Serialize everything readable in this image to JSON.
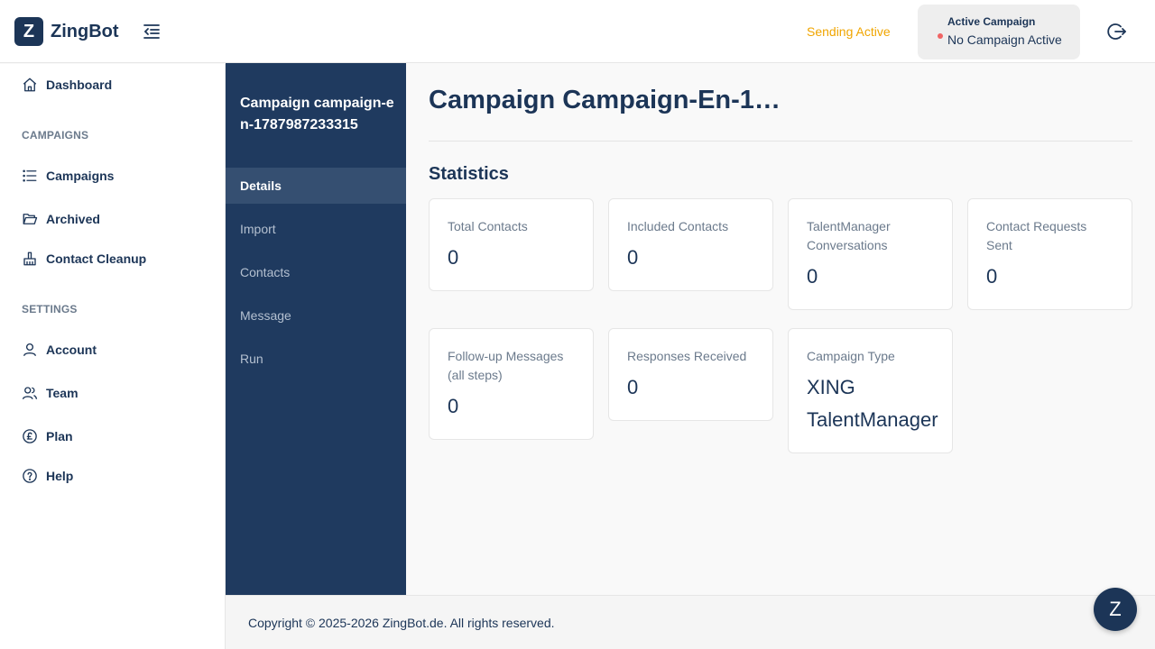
{
  "app": {
    "logo_letter": "Z",
    "name": "ZingBot"
  },
  "header": {
    "sending_status": "Sending Active",
    "active_campaign_title": "Active Campaign",
    "active_campaign_value": "No Campaign Active",
    "status_color": "#f0a500"
  },
  "sidebar": {
    "dashboard": "Dashboard",
    "campaigns_section": "CAMPAIGNS",
    "campaigns": "Campaigns",
    "archived": "Archived",
    "contact_cleanup": "Contact Cleanup",
    "settings_section": "SETTINGS",
    "account": "Account",
    "team": "Team",
    "plan": "Plan",
    "help": "Help"
  },
  "subnav": {
    "title": "Campaign campaign-en-1787987233315",
    "items": [
      "Details",
      "Import",
      "Contacts",
      "Message",
      "Run"
    ],
    "active": "Details"
  },
  "main": {
    "title": "Campaign Campaign-En-1…",
    "stats_title": "Statistics",
    "cards": [
      {
        "label": "Total Contacts",
        "value": "0"
      },
      {
        "label": "Included Contacts",
        "value": "0"
      },
      {
        "label": "TalentManager Conversations",
        "value": "0"
      },
      {
        "label": "Contact Requests Sent",
        "value": "0"
      },
      {
        "label": "Follow-up Messages (all steps)",
        "value": "0"
      },
      {
        "label": "Responses Received",
        "value": "0"
      },
      {
        "label": "Campaign Type",
        "value": "XING TalentManager"
      }
    ]
  },
  "footer": {
    "copyright": "Copyright © 2025-2026 ZingBot.de. All rights reserved."
  },
  "chat": {
    "letter": "Z"
  },
  "colors": {
    "primary": "#1c3557",
    "subnav_bg": "#1f3a5f",
    "accent": "#f0a500",
    "dot": "#f06464"
  }
}
